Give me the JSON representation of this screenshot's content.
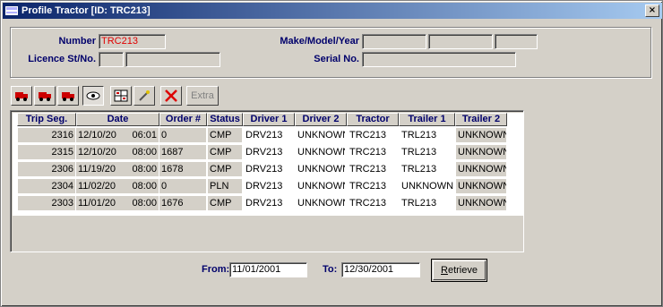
{
  "window": {
    "title": "Profile Tractor [ID: TRC213]",
    "close_glyph": "×"
  },
  "header": {
    "number_label": "Number",
    "number_value": "TRC213",
    "licence_label": "Licence St/No.",
    "licence_state": "",
    "licence_number": "",
    "make_label": "Make/Model/Year",
    "make_value": "",
    "model_value": "",
    "year_value": "",
    "serial_label": "Serial No.",
    "serial_value": ""
  },
  "toolbar": {
    "buttons": [
      {
        "icon": "truck-icon"
      },
      {
        "icon": "truck-icon"
      },
      {
        "icon": "truck-icon"
      },
      {
        "icon": "eye-icon"
      },
      {
        "icon": "calculator-icon"
      },
      {
        "icon": "pencil-icon"
      },
      {
        "icon": "delete-x-icon"
      }
    ],
    "extra_label": "Extra"
  },
  "grid": {
    "columns": [
      "Trip Seg.",
      "Date",
      "Order #",
      "Status",
      "Driver 1",
      "Driver 2",
      "Tractor",
      "Trailer 1",
      "Trailer 2"
    ],
    "rows": [
      {
        "trip_seg": "2316",
        "date": "12/10/20",
        "time": "06:01",
        "order": "0",
        "status": "CMP",
        "driver1": "DRV213",
        "driver2": "UNKNOWN",
        "tractor": "TRC213",
        "trailer1": "TRL213",
        "trailer2": "UNKNOWN"
      },
      {
        "trip_seg": "2315",
        "date": "12/10/20",
        "time": "08:00",
        "order": "1687",
        "status": "CMP",
        "driver1": "DRV213",
        "driver2": "UNKNOWN",
        "tractor": "TRC213",
        "trailer1": "TRL213",
        "trailer2": "UNKNOWN"
      },
      {
        "trip_seg": "2306",
        "date": "11/19/20",
        "time": "08:00",
        "order": "1678",
        "status": "CMP",
        "driver1": "DRV213",
        "driver2": "UNKNOWN",
        "tractor": "TRC213",
        "trailer1": "TRL213",
        "trailer2": "UNKNOWN"
      },
      {
        "trip_seg": "2304",
        "date": "11/02/20",
        "time": "08:00",
        "order": "0",
        "status": "PLN",
        "driver1": "DRV213",
        "driver2": "UNKNOWN",
        "tractor": "TRC213",
        "trailer1": "UNKNOWN",
        "trailer2": "UNKNOWN"
      },
      {
        "trip_seg": "2303",
        "date": "11/01/20",
        "time": "08:00",
        "order": "1676",
        "status": "CMP",
        "driver1": "DRV213",
        "driver2": "UNKNOWN",
        "tractor": "TRC213",
        "trailer1": "TRL213",
        "trailer2": "UNKNOWN"
      }
    ]
  },
  "filter": {
    "from_label": "From:",
    "from_value": "11/01/2001",
    "to_label": "To:",
    "to_value": "12/30/2001",
    "retrieve_label": "Retrieve"
  },
  "colors": {
    "label_blue": "#00006b",
    "number_red": "#e00000",
    "title_start": "#0a246a",
    "title_end": "#a6caf0"
  }
}
